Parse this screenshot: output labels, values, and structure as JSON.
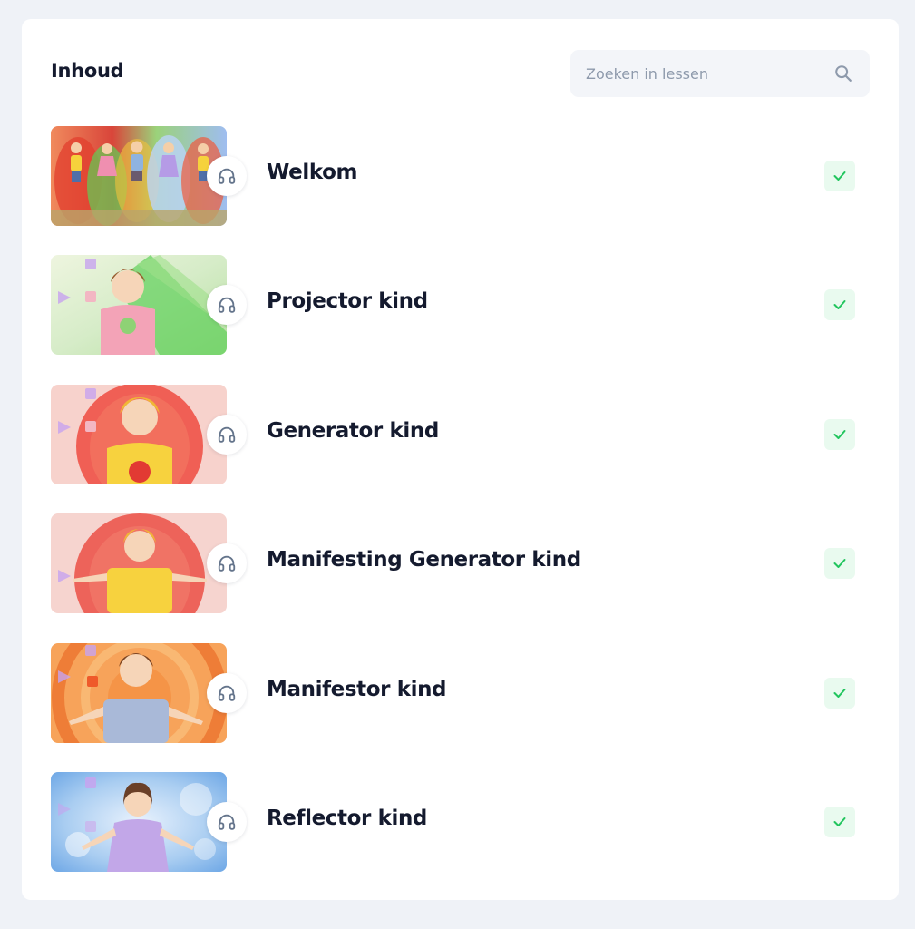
{
  "header": {
    "title": "Inhoud"
  },
  "search": {
    "placeholder": "Zoeken in lessen",
    "icon": "search-icon"
  },
  "lessons": [
    {
      "title": "Welkom",
      "completed": true,
      "media": "audio",
      "thumb_palette": [
        "#e8563f",
        "#7fd06a",
        "#9ab8ee"
      ]
    },
    {
      "title": "Projector kind",
      "completed": true,
      "media": "audio",
      "thumb_palette": [
        "#cfe6c4",
        "#5fd05a",
        "#f3b7c3"
      ]
    },
    {
      "title": "Generator kind",
      "completed": true,
      "media": "audio",
      "thumb_palette": [
        "#f5b7ae",
        "#ea3b30",
        "#f6c935"
      ]
    },
    {
      "title": "Manifesting Generator kind",
      "completed": true,
      "media": "audio",
      "thumb_palette": [
        "#f3c2bb",
        "#e6413a",
        "#f6d23c"
      ]
    },
    {
      "title": "Manifestor kind",
      "completed": true,
      "media": "audio",
      "thumb_palette": [
        "#f7a35a",
        "#e7641f",
        "#9fb4d8"
      ]
    },
    {
      "title": "Reflector kind",
      "completed": true,
      "media": "audio",
      "thumb_palette": [
        "#bcd6f2",
        "#6fa8e6",
        "#c9b4ea"
      ]
    }
  ],
  "colors": {
    "check_bg": "#e9faef",
    "check": "#22c55e",
    "text": "#141a2e",
    "background": "#eff2f7"
  }
}
